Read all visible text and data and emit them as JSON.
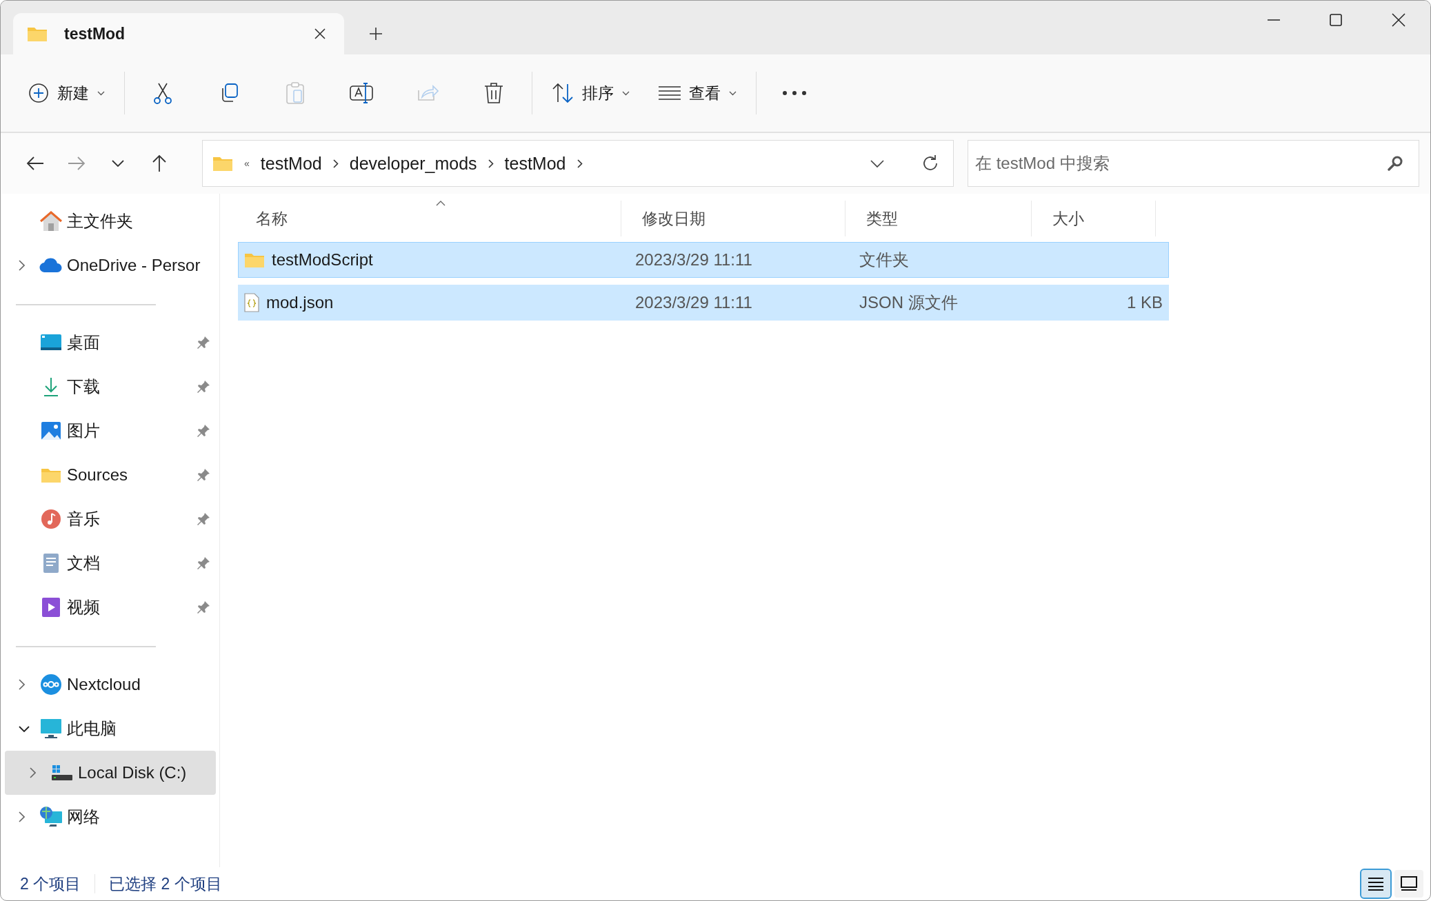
{
  "tabs": [
    {
      "title": "testMod",
      "selected": true
    }
  ],
  "toolbar": {
    "groups": [
      {
        "tools": [
          {
            "kind": "new",
            "label": "新建",
            "disabled": false
          }
        ]
      },
      {
        "tools": [
          {
            "kind": "cut",
            "disabled": false
          },
          {
            "kind": "copy",
            "disabled": false
          },
          {
            "kind": "paste",
            "disabled": true
          },
          {
            "kind": "rename",
            "disabled": false
          },
          {
            "kind": "share",
            "disabled": true
          },
          {
            "kind": "delete",
            "disabled": false
          }
        ]
      },
      {
        "tools": [
          {
            "kind": "sort",
            "label": "排序",
            "disabled": false
          },
          {
            "kind": "view",
            "label": "查看",
            "disabled": false
          }
        ]
      },
      {
        "tools": [
          {
            "kind": "more",
            "disabled": false
          }
        ]
      }
    ]
  },
  "navigation": [
    {
      "kind": "back",
      "disabled": false
    },
    {
      "kind": "forward",
      "disabled": true
    },
    {
      "kind": "recent",
      "disabled": false
    },
    {
      "kind": "up",
      "disabled": false
    }
  ],
  "address": {
    "overflow": "«",
    "crumbs": [
      "testMod",
      "developer_mods",
      "testMod"
    ]
  },
  "search": {
    "placeholder": "在 testMod 中搜索"
  },
  "sidebar": {
    "groups": [
      {
        "items": [
          {
            "kind": "home",
            "label": "主文件夹",
            "selected": false
          },
          {
            "kind": "cloud",
            "label": "OneDrive - Persor",
            "expanded": false,
            "selected": false
          }
        ]
      },
      {
        "items": [
          {
            "kind": "desktop",
            "label": "桌面",
            "pinned": true,
            "selected": false
          },
          {
            "kind": "download",
            "label": "下载",
            "pinned": true,
            "selected": false
          },
          {
            "kind": "pictures",
            "label": "图片",
            "pinned": true,
            "selected": false
          },
          {
            "kind": "folder",
            "label": "Sources",
            "pinned": true,
            "selected": false
          },
          {
            "kind": "music",
            "label": "音乐",
            "pinned": true,
            "selected": false
          },
          {
            "kind": "documents",
            "label": "文档",
            "pinned": true,
            "selected": false
          },
          {
            "kind": "videos",
            "label": "视频",
            "pinned": true,
            "selected": false
          }
        ]
      },
      {
        "items": [
          {
            "kind": "nextcloud",
            "label": "Nextcloud",
            "expanded": false,
            "selected": false
          },
          {
            "kind": "pc",
            "label": "此电脑",
            "expanded": true,
            "selected": false,
            "children": [
              {
                "kind": "drive",
                "label": "Local Disk (C:)",
                "expanded": false,
                "selected": true
              }
            ]
          },
          {
            "kind": "network",
            "label": "网络",
            "expanded": false,
            "selected": false
          }
        ]
      }
    ]
  },
  "table": {
    "columns": [
      {
        "label": "名称",
        "sorted": true
      },
      {
        "label": "修改日期",
        "sorted": false
      },
      {
        "label": "类型",
        "sorted": false
      },
      {
        "label": "大小",
        "sorted": false
      }
    ],
    "rows": [
      {
        "kind": "folder",
        "name": "testModScript",
        "modified": "2023/3/29 11:11",
        "type": "文件夹",
        "selected": true,
        "focused": true
      },
      {
        "kind": "json",
        "name": "mod.json",
        "modified": "2023/3/29 11:11",
        "type": "JSON 源文件",
        "size": "1 KB",
        "selected": true,
        "focused": false
      }
    ]
  },
  "status_bar": {
    "item_count": "2 个项目",
    "selection": "已选择 2 个项目"
  },
  "view_modes": [
    {
      "kind": "details",
      "selected": true
    },
    {
      "kind": "tiles",
      "selected": false
    }
  ]
}
